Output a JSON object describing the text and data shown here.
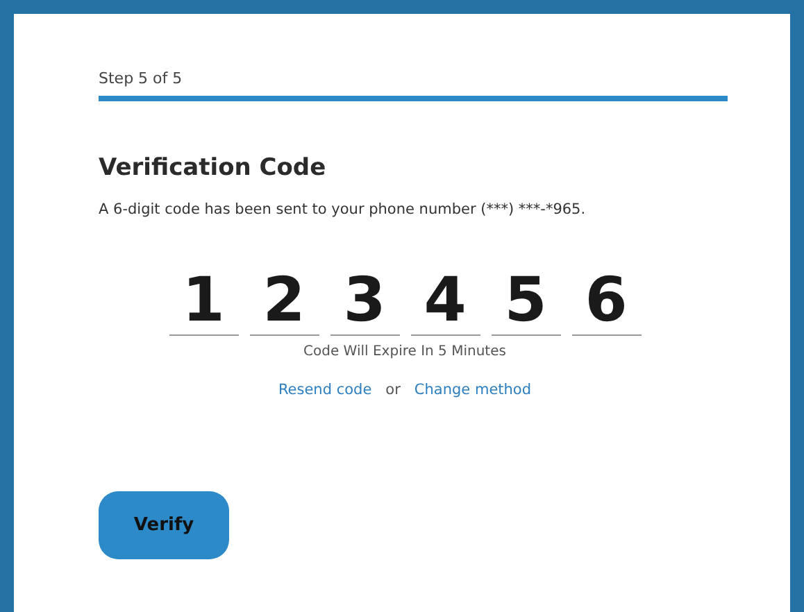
{
  "progress": {
    "label": "Step 5 of 5",
    "level": 1
  },
  "title": "Verification Code",
  "description": "A 6-digit code has been sent to your phone number (***) ***-*965.",
  "code_digits": [
    "1",
    "2",
    "3",
    "4",
    "5",
    "6"
  ],
  "expiry_note": "Code Will Expire In 5 Minutes",
  "links": {
    "resend": "Resend code",
    "separator": "or",
    "change": "Change method"
  },
  "button": "Verify"
}
